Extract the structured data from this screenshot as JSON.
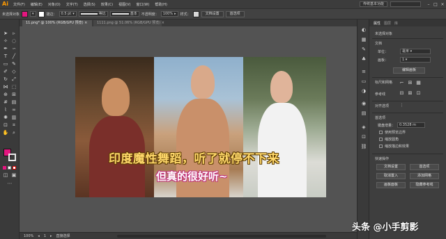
{
  "app": {
    "logo": "Ai"
  },
  "menubar": {
    "items": [
      "文件(F)",
      "编辑(E)",
      "对象(O)",
      "文字(T)",
      "选择(S)",
      "效果(C)",
      "视图(V)",
      "窗口(W)",
      "帮助(H)"
    ],
    "workspace": "传统基本功能",
    "window_controls": [
      "–",
      "□",
      "×"
    ]
  },
  "controlbar": {
    "selection_label": "未选择对象",
    "fill_color": "#e3167f",
    "stroke_label": "描边：",
    "stroke_weight": "0.5 pt",
    "stroke_profile": "等比",
    "brush": "基本",
    "opacity_label": "不透明度：",
    "opacity": "100%",
    "style_label": "样式：",
    "doc_setup_button": "文档设置",
    "preferences_button": "首选项"
  },
  "tabs": [
    {
      "label": "11.png* @ 100% (RGB/GPU 预览)"
    },
    {
      "label": "1111.png @ 51.06% (RGB/GPU 预览)"
    }
  ],
  "artwork": {
    "caption_line1": "印度魔性舞蹈，听了就停不下来",
    "caption_line2": "但真的很好听~"
  },
  "statusbar": {
    "zoom": "100%",
    "page": "1",
    "tool_name": "直接选择"
  },
  "properties": {
    "tabs": [
      "属性",
      "图层",
      "库"
    ],
    "no_selection": "未选择对象",
    "document_label": "文档",
    "units_label": "单位：",
    "units_value": "毫米",
    "artboard_label": "画板：",
    "artboard_value": "1",
    "edit_artboards_button": "编辑画板",
    "ruler_grid_label": "标尺和网格",
    "guides_label": "参考线",
    "align_label": "对齐选项",
    "preferences_label": "首选项",
    "keyboard_increment_label": "键盘增量：",
    "keyboard_increment_value": "0.3528 m",
    "checkbox_1": "使用预览边界",
    "checkbox_2": "缩放圆角",
    "checkbox_3": "缩放描边和效果",
    "quick_actions_label": "快速操作",
    "btn_doc_setup": "文档设置",
    "btn_preferences": "首选项",
    "btn_place": "取消置入",
    "btn_grid": "添加网格",
    "btn_artboard": "画板面板",
    "btn_guides": "隐藏参考线"
  },
  "watermark": "头条 @小手剪影"
}
